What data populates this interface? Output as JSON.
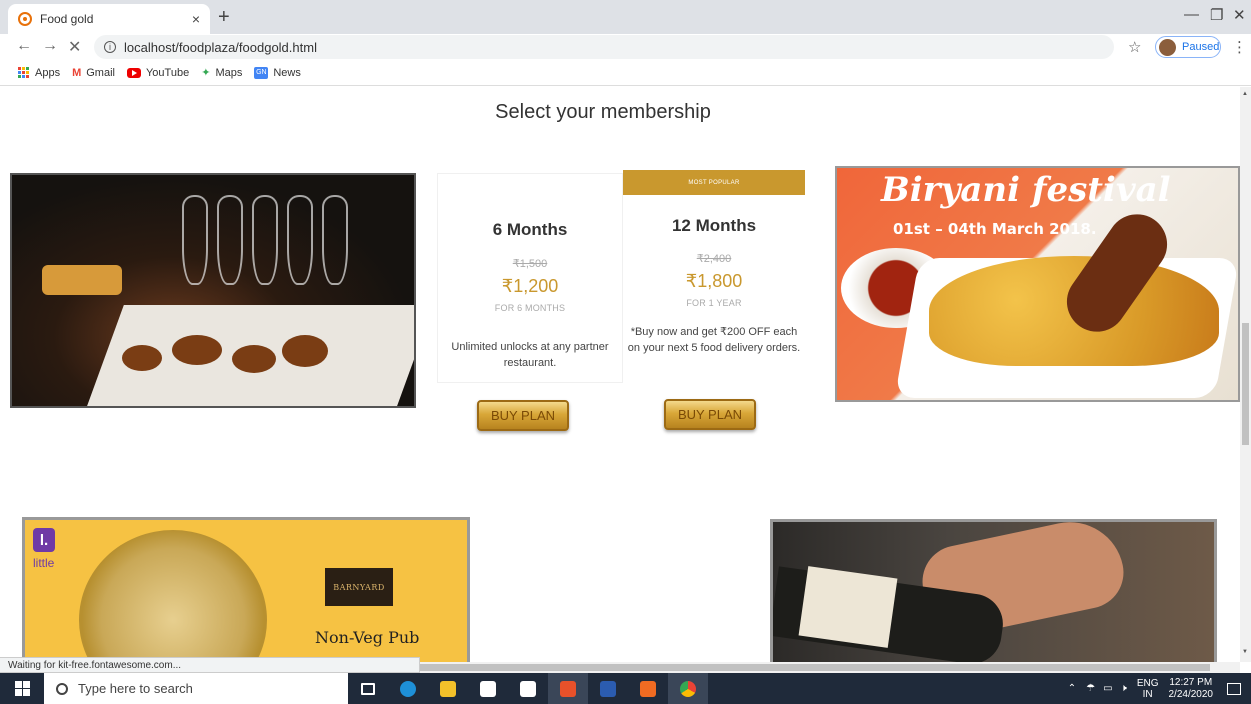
{
  "browser": {
    "tab_title": "Food gold",
    "tab_close": "×",
    "new_tab": "+",
    "url": "localhost/foodplaza/foodgold.html",
    "profile_status": "Paused",
    "bookmarks": [
      "Apps",
      "Gmail",
      "YouTube",
      "Maps",
      "News"
    ],
    "status_text": "Waiting for kit-free.fontawesome.com..."
  },
  "page": {
    "title": "Select your membership",
    "promo_heading": "Biryani festival",
    "promo_dates": "01st – 04th March 2018.",
    "little_brand": "little",
    "little_logo": "l.",
    "barnyard_logo": "BARNYARD",
    "pub_text": "Non-Veg Pub"
  },
  "plans": [
    {
      "name": "6 Months",
      "old_price": "₹1,500",
      "price": "₹1,200",
      "period": "FOR 6 MONTHS",
      "description": "Unlimited unlocks at any partner restaurant.",
      "button": "BUY PLAN"
    },
    {
      "ribbon": "MOST POPULAR",
      "name": "12 Months",
      "old_price": "₹2,400",
      "price": "₹1,800",
      "period": "FOR 1 YEAR",
      "description": "*Buy now and get ₹200 OFF each on your next 5 food delivery orders.",
      "button": "BUY PLAN"
    }
  ],
  "taskbar": {
    "search_placeholder": "Type here to search",
    "lang_top": "ENG",
    "lang_bottom": "IN",
    "time": "12:27 PM",
    "date": "2/24/2020"
  },
  "colors": {
    "gold": "#c9982e",
    "taskbar": "#1f2a3a"
  }
}
